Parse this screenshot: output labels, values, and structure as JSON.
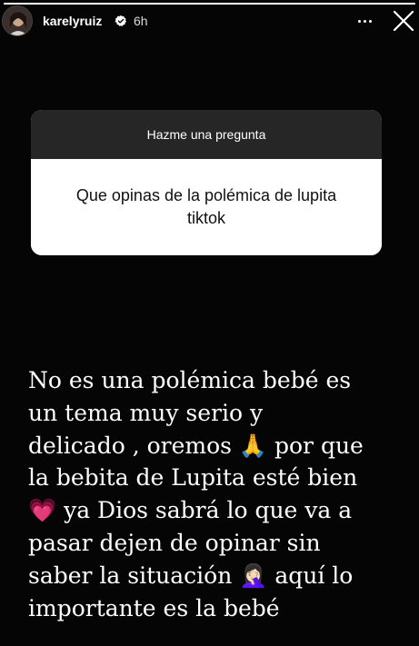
{
  "story": {
    "progress": 1.0,
    "header": {
      "username": "karelyruiz",
      "verified": true,
      "time_ago": "6h",
      "avatar_icon": "avatar-profile-photo",
      "more_icon": "more-horizontal-icon",
      "close_icon": "close-icon"
    },
    "question_sticker": {
      "prompt": "Hazme una pregunta",
      "question": "Que opinas de la polémica de lupita tiktok"
    },
    "answer_text": "No es una polémica bebé es\nun tema muy serio y\ndelicado , oremos 🙏 por que\nla bebita de Lupita esté bien\n💗 ya Dios sabrá lo que va a\npasar dejen de opinar sin\nsaber la situación 🤦🏻‍♀️ aquí lo\nimportante es la bebé"
  },
  "colors": {
    "background": "#050505",
    "sticker_header": "#262626",
    "sticker_body": "#ffffff",
    "verified_badge": "#ffffff"
  }
}
